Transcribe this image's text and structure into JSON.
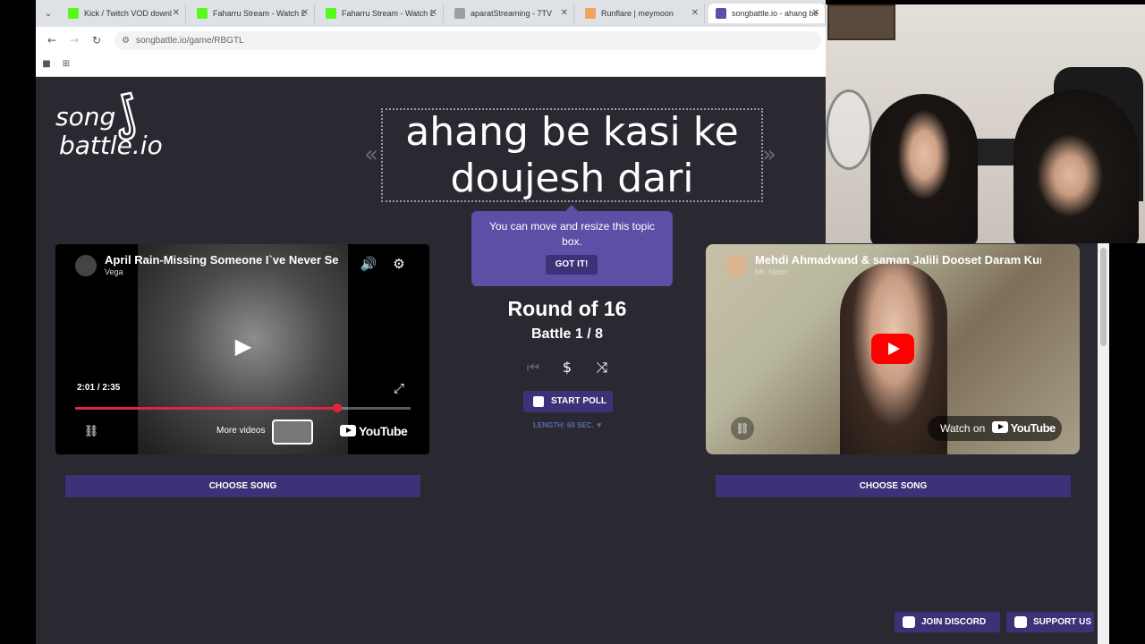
{
  "browser": {
    "tabs": [
      {
        "title": "Kick / Twitch VOD downl",
        "favicon_color": "#53fc18"
      },
      {
        "title": "Faharru Stream - Watch L",
        "favicon_color": "#53fc18"
      },
      {
        "title": "Faharru Stream - Watch L",
        "favicon_color": "#53fc18"
      },
      {
        "title": "aparatStreaming - 7TV",
        "favicon_color": "#9e9e9e"
      },
      {
        "title": "Runflare | meymoon",
        "favicon_color": "#f0a45e"
      },
      {
        "title": "songbattle.io - ahang be",
        "favicon_color": "#5c4fa6"
      }
    ],
    "url": "songbattle.io/game/RBGTL"
  },
  "logo": {
    "line1": "song",
    "line2": "battle.io"
  },
  "topic": {
    "text": "ahang be kasi ke doujesh dari",
    "prev_arrow": "«",
    "next_arrow": "»"
  },
  "tooltip": {
    "message": "You can move and resize this topic box.",
    "button": "GOT IT!"
  },
  "round": {
    "title": "Round of 16",
    "battle": "Battle 1 / 8"
  },
  "controls": {
    "start_poll": "START POLL",
    "length": "LENGTH: 60 SEC. ▼"
  },
  "left_video": {
    "title": "April Rain-Missing Someone I`ve Never Se",
    "channel": "Vega",
    "time": "2:01 / 2:35",
    "progress": 0.78,
    "more_videos": "More videos",
    "youtube": "YouTube"
  },
  "right_video": {
    "title": "Mehdi Ahmadvand & saman Jalili Dooset Daram Kurd",
    "channel": "Mr. Noori",
    "watch_on": "Watch on",
    "youtube": "YouTube"
  },
  "choose_song": "CHOOSE SONG",
  "footer": {
    "discord": "JOIN DISCORD",
    "support": "SUPPORT US"
  },
  "colors": {
    "accent": "#3d3278",
    "tooltip": "#5c4fa6",
    "background": "#2a2831",
    "progress": "#e6233f"
  }
}
